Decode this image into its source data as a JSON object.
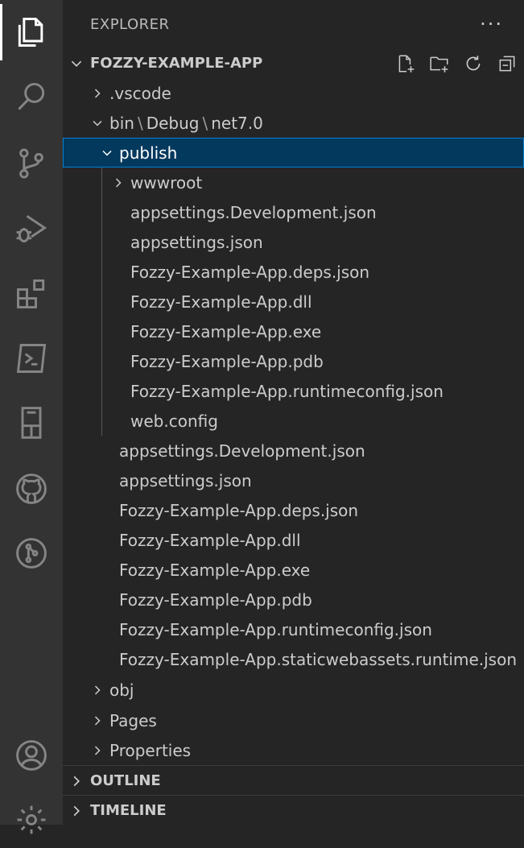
{
  "explorer": {
    "title": "EXPLORER",
    "more_label": "···"
  },
  "project": {
    "title": "FOZZY-EXAMPLE-APP"
  },
  "path": {
    "bin": "bin",
    "debug": "Debug",
    "net": "net7.0"
  },
  "tree": {
    "vscode": ".vscode",
    "publish": "publish",
    "wwwroot": "wwwroot",
    "publish_files": [
      "appsettings.Development.json",
      "appsettings.json",
      "Fozzy-Example-App.deps.json",
      "Fozzy-Example-App.dll",
      "Fozzy-Example-App.exe",
      "Fozzy-Example-App.pdb",
      "Fozzy-Example-App.runtimeconfig.json",
      "web.config"
    ],
    "net_files": [
      "appsettings.Development.json",
      "appsettings.json",
      "Fozzy-Example-App.deps.json",
      "Fozzy-Example-App.dll",
      "Fozzy-Example-App.exe",
      "Fozzy-Example-App.pdb",
      "Fozzy-Example-App.runtimeconfig.json",
      "Fozzy-Example-App.staticwebassets.runtime.json"
    ],
    "obj": "obj",
    "pages": "Pages",
    "properties": "Properties"
  },
  "sections": {
    "outline": "OUTLINE",
    "timeline": "TIMELINE"
  },
  "icons": {
    "activity": [
      "explorer-icon",
      "search-icon",
      "source-control-icon",
      "run-debug-icon",
      "extensions-icon",
      "remote-explorer-icon",
      "testing-icon",
      "github-icon",
      "git-graph-icon",
      "accounts-icon",
      "settings-gear-icon"
    ],
    "toolbar": [
      "new-file-icon",
      "new-folder-icon",
      "refresh-icon",
      "collapse-all-icon"
    ]
  },
  "colors": {
    "selection_bg": "#04395e",
    "selection_border": "#007fd4",
    "activity_bg": "#333333",
    "sidebar_bg": "#252526"
  }
}
